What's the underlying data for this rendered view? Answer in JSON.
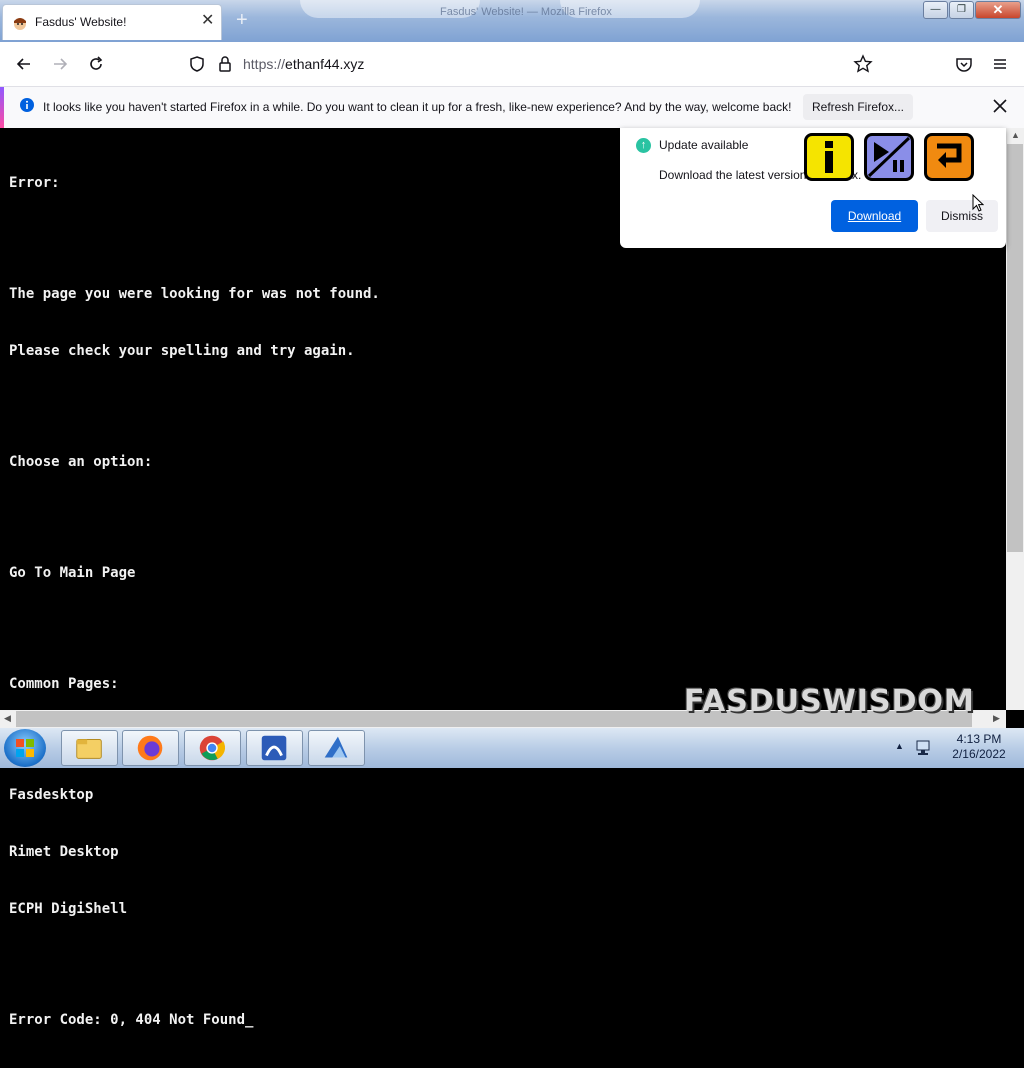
{
  "browser": {
    "window_title": "Fasdus' Website! — Mozilla Firefox",
    "tab": {
      "title": "Fasdus' Website!"
    },
    "new_tab_label": "+",
    "window_buttons": {
      "minimize": "—",
      "restore": "❐",
      "close": "✕"
    },
    "url": {
      "scheme": "https://",
      "host": "ethanf44.xyz"
    }
  },
  "notification_bar": {
    "message": "It looks like you haven't started Firefox in a while. Do you want to clean it up for a fresh, like-new experience? And by the way, welcome back!",
    "refresh_button": "Refresh Firefox..."
  },
  "page": {
    "lines": {
      "error": "Error:",
      "msg1": "The page you were looking for was not found.",
      "msg2": "Please check your spelling and try again.",
      "choose": "Choose an option:",
      "main": "Go To Main Page",
      "common": "Common Pages:",
      "p1": "Fasdesktop",
      "p2": "Rimet Desktop",
      "p3": "ECPH DigiShell",
      "code": "Error Code: 0, 404 Not Found_"
    }
  },
  "update_popup": {
    "title": "Update available",
    "description": "Download the latest version",
    "description_tail": "x.",
    "download_button": "Download",
    "dismiss_button": "Dismiss"
  },
  "overlay_icons": [
    "info-icon",
    "play-pause-icon",
    "return-icon"
  ],
  "watermark": "FASDUSWISDOM",
  "taskbar": {
    "time": "4:13 PM",
    "date": "2/16/2022",
    "pinned": [
      "file-explorer-icon",
      "firefox-icon",
      "chrome-icon",
      "app-icon",
      "app-icon-2"
    ]
  },
  "colors": {
    "accent": "#0061e0",
    "update_green": "#2ac3a2",
    "terminal_bg": "#000000",
    "terminal_fg": "#f2f2f2"
  }
}
